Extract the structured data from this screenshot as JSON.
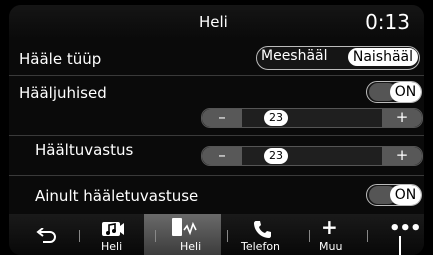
{
  "header": {
    "title": "Heli",
    "clock": "0:13"
  },
  "voice_type": {
    "label": "Hääle tüüp",
    "option_a": "Meeshääl",
    "option_b": "Naishääl"
  },
  "guidance": {
    "label": "Hääljuhised",
    "toggle": "ON",
    "value": "23"
  },
  "voice_recognition": {
    "label": "Häältuvastus",
    "value": "23"
  },
  "voice_only": {
    "label": "Ainult hääletuvastuse",
    "toggle": "ON"
  },
  "nav": {
    "items": [
      {
        "label": "",
        "icon": "back-arrow-icon"
      },
      {
        "label": "Heli",
        "icon": "music-note-icon"
      },
      {
        "label": "Heli",
        "icon": "waveform-icon"
      },
      {
        "label": "Telefon",
        "icon": "phone-icon"
      },
      {
        "label": "Muu",
        "icon": "plus-icon"
      },
      {
        "label": "",
        "icon": "more-dots-icon"
      }
    ]
  },
  "stepper_buttons": {
    "minus": "–",
    "plus": "+"
  }
}
